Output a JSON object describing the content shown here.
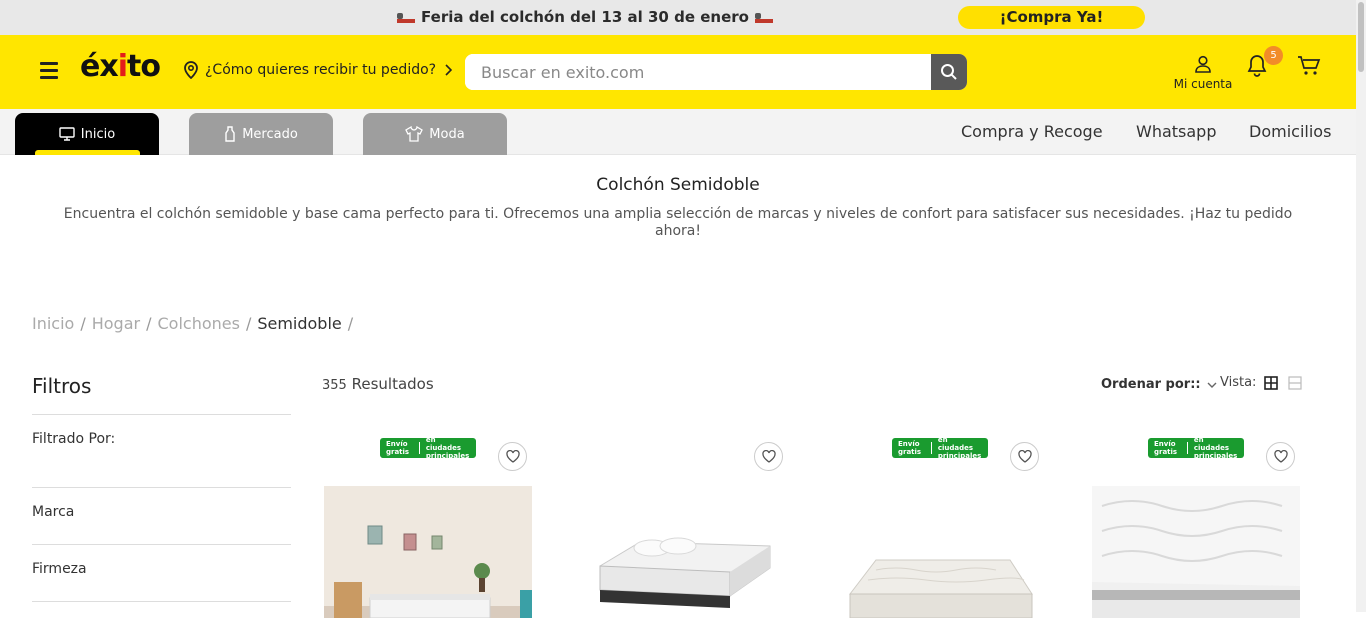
{
  "promo": {
    "text": "Feria del colchón del 13 al 30 de enero",
    "cta": "¡Compra Ya!"
  },
  "header": {
    "logo": "éxito",
    "location_prompt": "¿Cómo quieres recibir tu pedido?",
    "search_placeholder": "Buscar en exito.com",
    "account_label": "Mi cuenta",
    "notifications_count": "5",
    "brand_color": "#ffe600"
  },
  "tabs": [
    {
      "label": "Inicio",
      "icon": "monitor-icon",
      "active": true
    },
    {
      "label": "Mercado",
      "icon": "bottle-icon",
      "active": false
    },
    {
      "label": "Moda",
      "icon": "shirt-icon",
      "active": false
    }
  ],
  "nav_links": [
    "Compra y Recoge",
    "Whatsapp",
    "Domicilios"
  ],
  "category": {
    "title": "Colchón Semidoble",
    "description": "Encuentra el colchón semidoble y base cama perfecto para ti. Ofrecemos una amplia selección de marcas y niveles de confort para satisfacer sus necesidades. ¡Haz tu pedido ahora!"
  },
  "breadcrumb": [
    "Inicio",
    "Hogar",
    "Colchones",
    "Semidoble"
  ],
  "filters": {
    "title": "Filtros",
    "filtered_by": "Filtrado Por:",
    "groups": [
      "Marca",
      "Firmeza"
    ]
  },
  "results": {
    "count": "355",
    "label": "Resultados",
    "sort_label": "Ordenar por::",
    "view_label": "Vista:"
  },
  "products": [
    {
      "free_shipping": true,
      "badge_line1": "Envío gratis",
      "badge_line2": "en ciudades principales"
    },
    {
      "free_shipping": false
    },
    {
      "free_shipping": true,
      "badge_line1": "Envío gratis",
      "badge_line2": "en ciudades principales"
    },
    {
      "free_shipping": true,
      "badge_line1": "Envío gratis",
      "badge_line2": "en ciudades principales"
    }
  ]
}
